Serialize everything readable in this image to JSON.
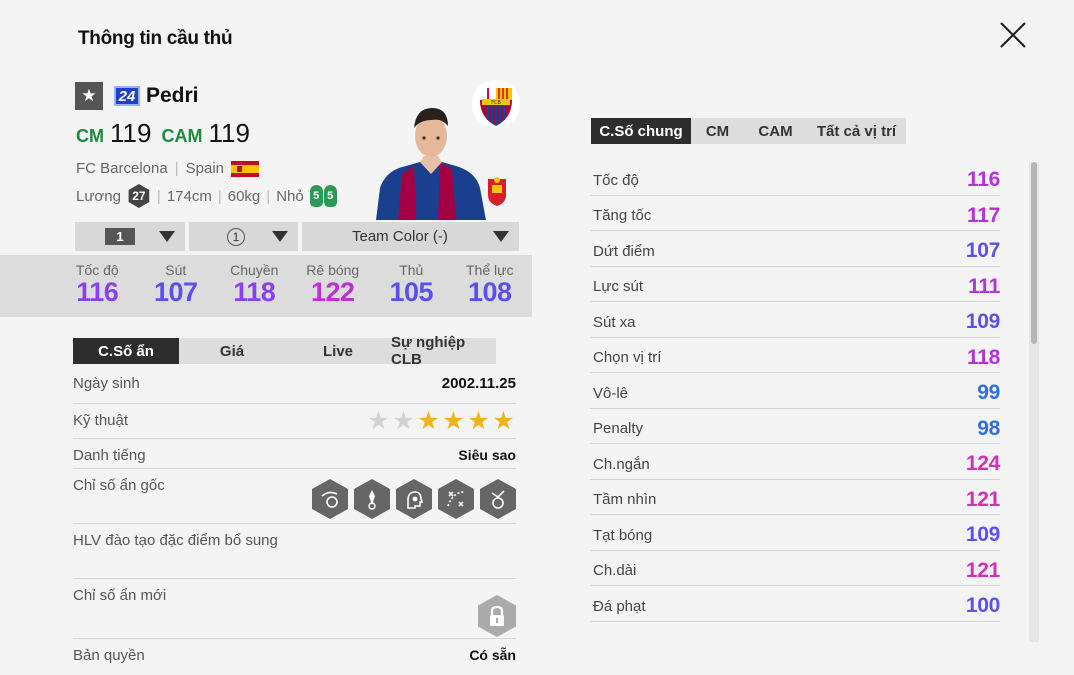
{
  "title": "Thông tin cầu thủ",
  "player": {
    "number": "24",
    "name": "Pedri",
    "positions": [
      {
        "pos": "CM",
        "ovr": "119"
      },
      {
        "pos": "CAM",
        "ovr": "119"
      }
    ],
    "club": "FC Barcelona",
    "nation": "Spain",
    "salary_label": "Lương",
    "salary": "27",
    "height": "174cm",
    "weight": "60kg",
    "body_type": "Nhỏ",
    "weak_foot_left": "5",
    "weak_foot_right": "5"
  },
  "dropdowns": {
    "level": "1",
    "ring": "1",
    "team_color": "Team Color (-)"
  },
  "main_stats": [
    {
      "label": "Tốc độ",
      "value": "116"
    },
    {
      "label": "Sút",
      "value": "107"
    },
    {
      "label": "Chuyền",
      "value": "118"
    },
    {
      "label": "Rê bóng",
      "value": "122"
    },
    {
      "label": "Thủ",
      "value": "105"
    },
    {
      "label": "Thể lực",
      "value": "108"
    }
  ],
  "left_tabs": [
    "C.Số ẩn",
    "Giá",
    "Live",
    "Sự nghiệp CLB"
  ],
  "info": {
    "birth_label": "Ngày sinh",
    "birth": "2002.11.25",
    "skill_label": "Kỹ thuật",
    "skill_stars": 4,
    "skill_max": 6,
    "fame_label": "Danh tiếng",
    "fame": "Siêu sao",
    "traits_label": "Chỉ số ẩn gốc",
    "traits_icons": [
      "trait-dribble-icon",
      "trait-playmaker-icon",
      "trait-head-icon",
      "trait-tactics-icon",
      "trait-shot-icon"
    ],
    "coach_label": "HLV đào tạo đặc điểm bổ sung",
    "new_traits_label": "Chỉ số ẩn mới",
    "license_label": "Bản quyền",
    "license": "Có sẵn"
  },
  "right_tabs": [
    "C.Số chung",
    "CM",
    "CAM",
    "Tất cả vị trí"
  ],
  "detail_stats": [
    {
      "label": "Tốc độ",
      "value": "116",
      "color": "#b531e0"
    },
    {
      "label": "Tăng tốc",
      "value": "117",
      "color": "#b531e0"
    },
    {
      "label": "Dứt điểm",
      "value": "107",
      "color": "#5a4ff0"
    },
    {
      "label": "Lực sút",
      "value": "111",
      "color": "#b531e0"
    },
    {
      "label": "Sút xa",
      "value": "109",
      "color": "#5a4ff0"
    },
    {
      "label": "Chọn vị trí",
      "value": "118",
      "color": "#b531e0"
    },
    {
      "label": "Vô-lê",
      "value": "99",
      "color": "#2f6fe0"
    },
    {
      "label": "Penalty",
      "value": "98",
      "color": "#2f6fe0"
    },
    {
      "label": "Ch.ngắn",
      "value": "124",
      "color": "#d62fb5"
    },
    {
      "label": "Tầm nhìn",
      "value": "121",
      "color": "#d62fb5"
    },
    {
      "label": "Tạt bóng",
      "value": "109",
      "color": "#5a4ff0"
    },
    {
      "label": "Ch.dài",
      "value": "121",
      "color": "#d62fb5"
    },
    {
      "label": "Đá phạt",
      "value": "100",
      "color": "#5a4ff0"
    }
  ]
}
